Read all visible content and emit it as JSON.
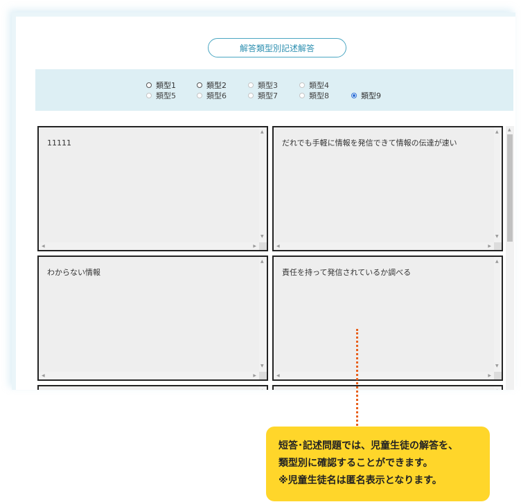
{
  "header": {
    "title": "解答類型別記述解答"
  },
  "filters": [
    {
      "label": "類型1",
      "state": "normal"
    },
    {
      "label": "類型2",
      "state": "normal"
    },
    {
      "label": "類型3",
      "state": "dim"
    },
    {
      "label": "類型4",
      "state": "dim"
    },
    {
      "label": "類型5",
      "state": "dim"
    },
    {
      "label": "類型6",
      "state": "dim"
    },
    {
      "label": "類型7",
      "state": "dim"
    },
    {
      "label": "類型8",
      "state": "dim"
    },
    {
      "label": "類型9",
      "state": "checked"
    }
  ],
  "answers": [
    {
      "text": "11111"
    },
    {
      "text": "だれでも手軽に情報を発信できて情報の伝達が速い"
    },
    {
      "text": "わからない情報"
    },
    {
      "text": "責任を持って発信されているか調べる"
    },
    {
      "text": ""
    },
    {
      "text": ""
    }
  ],
  "callout": {
    "line1": "短答･記述問題では、児童生徒の解答を、",
    "line2": "類型別に確認することができます。",
    "line3": "※児童生徒名は匿名表示となります。"
  },
  "colors": {
    "accent": "#2d8fb0",
    "filter_bg": "#ddeff4",
    "callout_bg": "#ffd62a",
    "dotline": "#e8601c"
  }
}
